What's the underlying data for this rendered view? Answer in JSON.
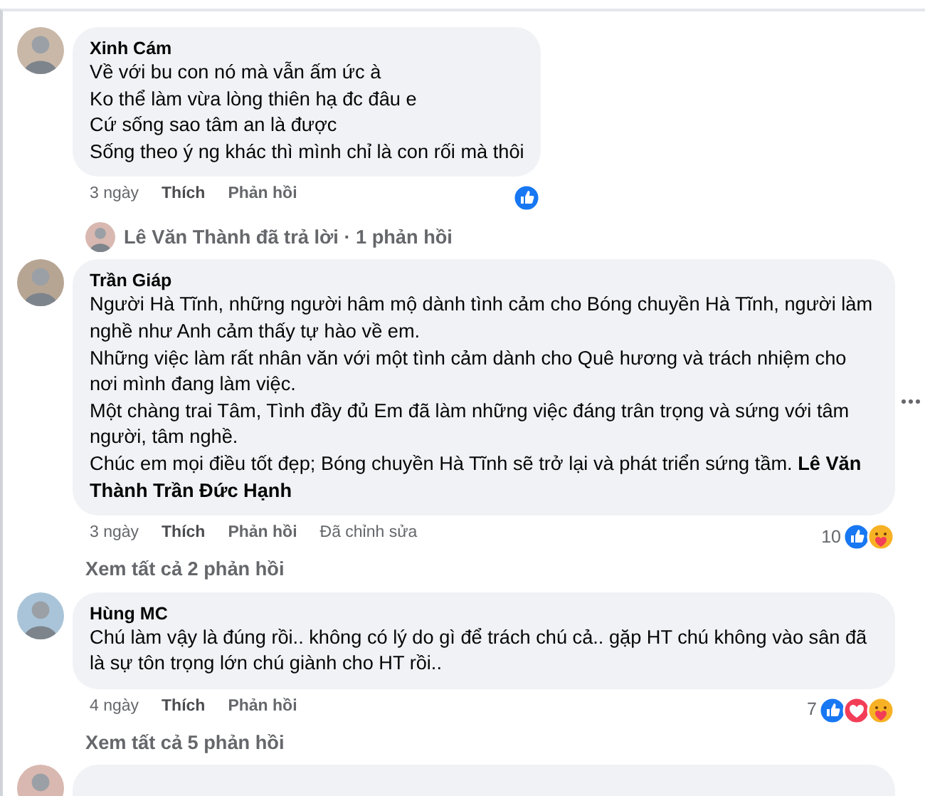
{
  "thread": [
    {
      "kind": "comment",
      "author": "Xinh Cám",
      "paragraphs": [
        "Về với bu con nó mà vẫn ấm ức à",
        "Ko thể làm vừa lòng thiên hạ đc đâu e",
        "Cứ sống sao tâm an là được",
        "Sống theo ý ng khác thì mình chỉ là con rối mà thôi"
      ],
      "meta": [
        {
          "kind": "time",
          "text": "3 ngày"
        },
        {
          "kind": "like",
          "text": "Thích"
        },
        {
          "kind": "reply",
          "text": "Phản hồi"
        }
      ],
      "reactions": [
        {
          "kind": "like"
        }
      ]
    },
    {
      "kind": "reply_summary",
      "text": "Lê Văn Thành đã trả lời · 1 phản hồi"
    },
    {
      "kind": "comment",
      "author": "Trần Giáp",
      "menu_visible": true,
      "paragraphs": [
        "Người Hà Tĩnh, những người hâm mộ dành tình cảm cho Bóng chuyền Hà Tĩnh, người làm nghề như Anh cảm thấy tự hào về em.",
        "Những việc làm rất nhân văn với một tình cảm dành cho Quê hương và trách nhiệm cho nơi mình đang làm việc.",
        "Một chàng trai Tâm, Tình đầy đủ Em đã làm những việc đáng trân trọng và sứng với tâm người, tâm nghề.",
        "Chúc em mọi điều tốt đẹp; Bóng chuyền Hà Tĩnh sẽ trở lại và phát triển sứng tầm. **Lê Văn Thành Trần Đức Hạnh**"
      ],
      "meta": [
        {
          "kind": "time",
          "text": "3 ngày"
        },
        {
          "kind": "like",
          "text": "Thích"
        },
        {
          "kind": "reply",
          "text": "Phản hồi"
        },
        {
          "kind": "edited",
          "text": "Đã chỉnh sửa"
        }
      ],
      "reaction_count": "10",
      "reactions": [
        {
          "kind": "like"
        },
        {
          "kind": "care"
        }
      ]
    },
    {
      "kind": "view_replies",
      "text": "Xem tất cả 2 phản hồi"
    },
    {
      "kind": "comment",
      "author": "Hùng MC",
      "paragraphs": [
        "Chú làm vậy là đúng rồi.. không có lý do gì để trách chú cả.. gặp HT chú không vào sân đã là sự tôn trọng lớn chú giành cho HT rồi.."
      ],
      "meta": [
        {
          "kind": "time",
          "text": "4 ngày"
        },
        {
          "kind": "like",
          "text": "Thích"
        },
        {
          "kind": "reply",
          "text": "Phản hồi"
        }
      ],
      "reaction_count": "7",
      "reactions": [
        {
          "kind": "like"
        },
        {
          "kind": "love"
        },
        {
          "kind": "care"
        }
      ]
    },
    {
      "kind": "view_replies",
      "text": "Xem tất cả 5 phản hồi"
    },
    {
      "kind": "cut_off_comment"
    }
  ]
}
